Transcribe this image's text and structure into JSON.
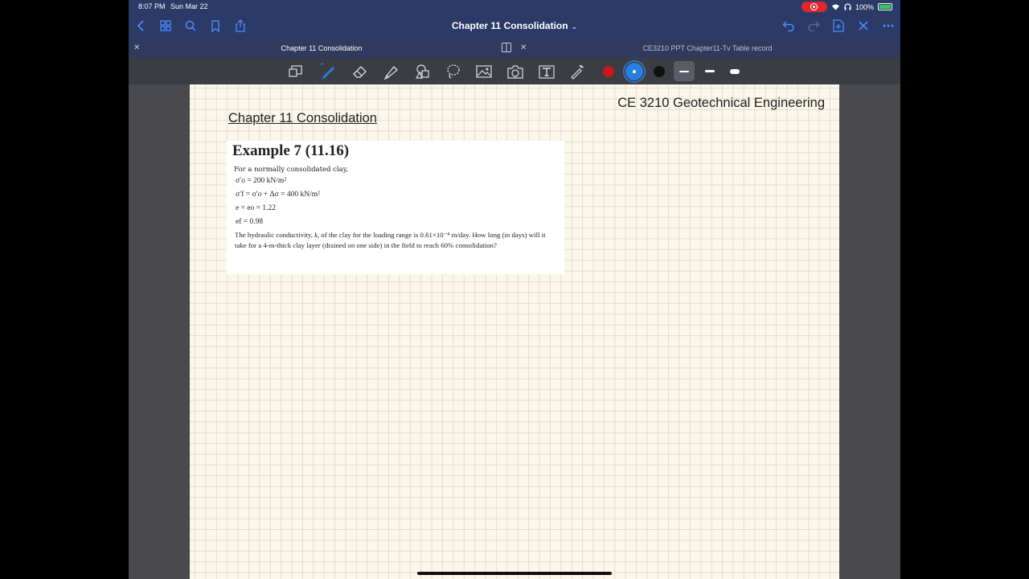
{
  "status": {
    "time": "8:07 PM",
    "date": "Sun Mar 22",
    "battery": "100%",
    "colors": {
      "record": "#e0262e",
      "battery_fill": "#35c759"
    }
  },
  "nav": {
    "title": "Chapter 11 Consolidation",
    "icons": [
      "chevron-left-icon",
      "grid-icon",
      "search-icon",
      "bookmark-icon",
      "share-icon",
      "undo-icon",
      "redo-icon",
      "add-page-icon",
      "close-icon",
      "more-icon"
    ]
  },
  "tabs": [
    {
      "label": "Chapter 11 Consolidation",
      "active": true
    },
    {
      "label": "CE3210 PPT Chapter11-Tv Table record",
      "active": false
    }
  ],
  "toolbar": {
    "tools": [
      "zoom-box-icon",
      "pen-icon",
      "eraser-icon",
      "highlighter-icon",
      "shapes-icon",
      "lasso-icon",
      "image-icon",
      "camera-icon",
      "text-icon",
      "laser-pointer-icon"
    ],
    "active_tool": "pen-icon",
    "colors": [
      "#c81a1a",
      "#2a7de1",
      "#111111"
    ],
    "active_color": "#2a7de1",
    "stroke_widths": [
      "thin",
      "medium",
      "thick"
    ],
    "active_stroke": "thin"
  },
  "page": {
    "course": "CE 3210 Geotechnical Engineering",
    "chapter": "Chapter 11 Consolidation",
    "example": {
      "heading": "Example 7 (11.16)",
      "intro": "For a normally consolidated clay,",
      "given": [
        "σ′o = 200 kN/m²",
        "σ′f = σ′o + Δσ = 400 kN/m²",
        "e = eo = 1.22",
        "ef = 0.98"
      ],
      "problem_a": "The hydraulic conductivity, ",
      "problem_k": "k",
      "problem_b": ", of the clay for the loading range is ",
      "problem_value": "0.61×10⁻⁴",
      "problem_c": " m/day. How long (in days) will it take for a 4-m-thick clay layer (drained on one side) in the field to reach 60% consolidation?"
    }
  }
}
